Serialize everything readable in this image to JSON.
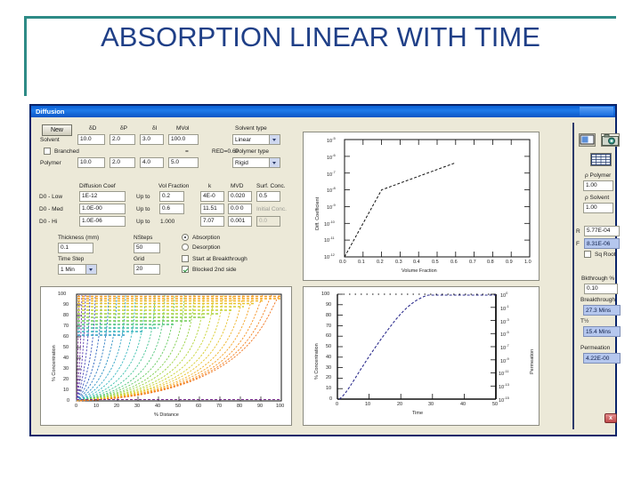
{
  "slide": {
    "title": "ABSORPTION LINEAR WITH TIME",
    "accent_color": "#2e8b86",
    "title_color": "#1f3f87"
  },
  "window": {
    "title": "Diffusion",
    "titlebar_color": "#0a5fd4",
    "face_color": "#ece9d8"
  },
  "form": {
    "new_button": "New",
    "column_headers": {
      "dd": "δD",
      "dp": "δP",
      "dh": "δI",
      "mvol": "MVol"
    },
    "solvent_row_label": "Solvent",
    "solvent_values": [
      "10.0",
      "2.0",
      "3.0",
      "100.0"
    ],
    "branched_label": "Branched",
    "branched_checked": false,
    "equals_sign": "=",
    "red_text": "RED=0.69",
    "polymer_row_label": "Polymer",
    "polymer_values": [
      "10.0",
      "2.0",
      "4.0",
      "5.0"
    ],
    "solvent_type_label": "Solvent type",
    "solvent_type_value": "Linear",
    "polymer_type_label": "Polymer type",
    "polymer_type_value": "Rigid",
    "diff_headers": {
      "coef": "Diffusion Coef",
      "volfrac": "Vol Fraction",
      "k": "k",
      "mvd": "MVD",
      "surfconc": "Surf. Conc."
    },
    "diff_rows": [
      {
        "label": "D0 - Low",
        "coef": "1E-12",
        "upto_label": "Up to",
        "volfrac": "0.2",
        "k": "4E-0",
        "mvd": "0.020",
        "surf": "0.5"
      },
      {
        "label": "D0 - Med",
        "coef": "1.0E-00",
        "upto_label": "Up to",
        "volfrac": "0.6",
        "k": "11.51",
        "mvd": "0.0 0",
        "surf": ""
      },
      {
        "label": "D0 - Hi",
        "coef": "1.0E-06",
        "upto_label": "Up to",
        "volfrac": "1.000",
        "k": "7.07",
        "mvd": "0.001",
        "surf": ""
      }
    ],
    "initial_conc_label": "Initial Conc.",
    "initial_conc_value": "0.0",
    "thickness_label": "Thickness (mm)",
    "thickness_value": "0.1",
    "timestep_label": "Time Step",
    "timestep_value": "1 Min",
    "nsteps_label": "NSteps",
    "nsteps_value": "50",
    "grid_label": "Grid",
    "grid_value": "20",
    "absorption_label": "Absorption",
    "desorption_label": "Desorption",
    "mode_selected": "Absorption",
    "start_breakthrough_label": "Start at Breakthrough",
    "start_breakthrough_checked": false,
    "blocked_label": "Blocked 2nd side",
    "blocked_checked": true
  },
  "right_panel": {
    "screen_icon": "screen-icon",
    "camera_icon": "camera-icon",
    "grid_icon": "grid-table-icon",
    "rho_polymer_label": "ρ Polymer",
    "rho_polymer_value": "1.00",
    "rho_solvent_label": "ρ Solvent",
    "rho_solvent_value": "1.00",
    "r_label": "R",
    "r_value": "5.77E-04",
    "f_label": "F",
    "f_value": "8.31E-06",
    "sqroot_label": "Sq Root",
    "sqroot_checked": false,
    "bkthrough_pct_label": "Bkthrough %",
    "bkthrough_pct_value": "0.10",
    "breakthrough_label": "Breakthrough",
    "breakthrough_value": "27.3 Mins",
    "thalf_label": "T½",
    "thalf_value": "15.4 Mins",
    "permeation_label": "Permeation",
    "permeation_value": "4.22E-00",
    "close_label": "x"
  },
  "chart_data": [
    {
      "id": "diff-coef-chart",
      "type": "line",
      "title": "",
      "xlabel": "Volume Fraction",
      "ylabel": "Diff. Coefficient",
      "xlim": [
        0.0,
        1.0
      ],
      "xticks": [
        "0.0",
        "0.1",
        "0.2",
        "0.3",
        "0.4",
        "0.5",
        "0.6",
        "0.7",
        "0.8",
        "0.9",
        "1.0"
      ],
      "yticks": [
        "10-5",
        "10-6",
        "10-7",
        "10-8",
        "10-9",
        "10-10",
        "10-11",
        "10-12"
      ],
      "ylim_log": [
        -12,
        -5
      ],
      "grid": false,
      "series": [
        {
          "name": "D vs volume fraction",
          "x": [
            0.0,
            0.2,
            0.6
          ],
          "y_log10": [
            -12.0,
            -8.0,
            -6.4
          ]
        }
      ]
    },
    {
      "id": "concentration-profile-chart",
      "type": "line",
      "title": "",
      "xlabel": "% Distance",
      "ylabel": "% Concentration",
      "xlim": [
        0,
        100
      ],
      "ylim": [
        0,
        100
      ],
      "xticks": [
        "0",
        "10",
        "20",
        "30",
        "40",
        "50",
        "60",
        "70",
        "80",
        "90",
        "100"
      ],
      "yticks": [
        "0",
        "10",
        "20",
        "30",
        "40",
        "50",
        "60",
        "70",
        "80",
        "90",
        "100"
      ],
      "grid": false,
      "note": "family of rainbow-coloured concentration profiles, low-to-high time",
      "colors": [
        "#7b2f8f",
        "#4040b0",
        "#2f7fc0",
        "#35b6c6",
        "#45c48a",
        "#86cc4e",
        "#c6d331",
        "#e8c22a",
        "#f59a1f",
        "#f07820"
      ]
    },
    {
      "id": "uptake-vs-time-chart",
      "type": "line",
      "title": "",
      "xlabel": "Time",
      "ylabel": "% Concentration",
      "y2label": "Permeation",
      "xlim": [
        0,
        50
      ],
      "ylim": [
        0,
        100
      ],
      "xticks": [
        "0",
        "10",
        "20",
        "30",
        "40",
        "50"
      ],
      "yticks": [
        "0",
        "10",
        "20",
        "30",
        "40",
        "50",
        "60",
        "70",
        "80",
        "90",
        "100"
      ],
      "y2ticks": [
        "100",
        "10-1",
        "10-3",
        "10-5",
        "10-7",
        "10-9",
        "10-11",
        "10-13",
        "10-15"
      ],
      "grid": false,
      "series": [
        {
          "name": "% Concentration vs time",
          "x": [
            0,
            2,
            5,
            8,
            12,
            16,
            20,
            24,
            28,
            31,
            34,
            36,
            40,
            45,
            50
          ],
          "y": [
            0,
            4,
            12,
            22,
            36,
            50,
            63,
            75,
            86,
            93,
            98,
            100,
            100,
            100,
            100
          ]
        }
      ]
    }
  ]
}
